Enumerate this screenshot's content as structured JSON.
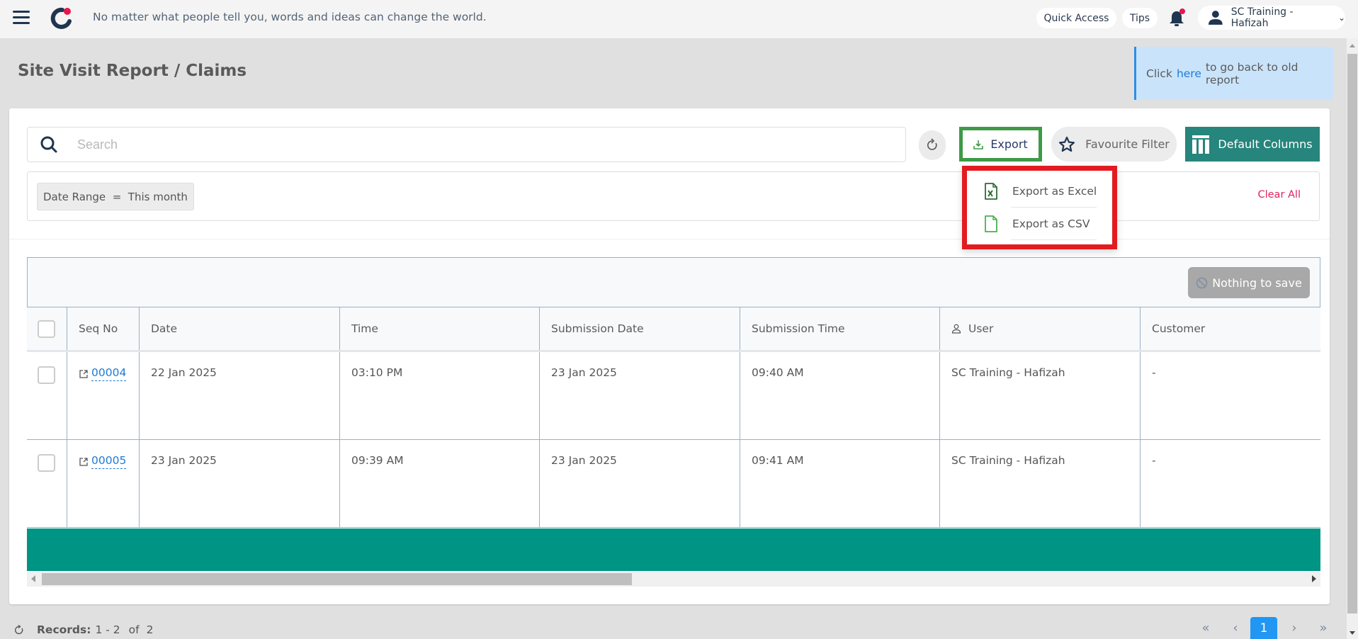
{
  "topbar": {
    "motto": "No matter what people tell you, words and ideas can change the world.",
    "quick_access": "Quick Access",
    "tips": "Tips",
    "user_name": "SC Training - Hafizah",
    "menu_icon": "hamburger-icon",
    "notification_icon": "bell-icon",
    "user_icon": "user-icon"
  },
  "page": {
    "title": "Site Visit Report / Claims",
    "banner_prefix": "Click",
    "banner_link": "here",
    "banner_suffix": "to go back to old report"
  },
  "toolbar": {
    "search_placeholder": "Search",
    "export_label": "Export",
    "favourite_label": "Favourite Filter",
    "columns_label": "Default Columns"
  },
  "filters": {
    "chip": "Date Range  =  This month",
    "clear_all": "Clear All"
  },
  "export_menu": {
    "items": [
      {
        "label": "Export as Excel",
        "icon": "excel-file-icon"
      },
      {
        "label": "Export as CSV",
        "icon": "csv-file-icon"
      }
    ]
  },
  "table": {
    "save_button": "Nothing to save",
    "columns": [
      "Seq No",
      "Date",
      "Time",
      "Submission Date",
      "Submission Time",
      "User",
      "Customer"
    ],
    "rows": [
      {
        "seq": "00004",
        "date": "22 Jan 2025",
        "time": "03:10 PM",
        "sub_date": "23 Jan 2025",
        "sub_time": "09:40 AM",
        "user": "SC Training - Hafizah",
        "customer": "-"
      },
      {
        "seq": "00005",
        "date": "23 Jan 2025",
        "time": "09:39 AM",
        "sub_date": "23 Jan 2025",
        "sub_time": "09:41 AM",
        "user": "SC Training - Hafizah",
        "customer": "-"
      }
    ]
  },
  "footer": {
    "records_label": "Records:",
    "records_range": "1 - 2",
    "records_of": "of",
    "records_total": "2",
    "current_page": "1",
    "first": "«",
    "prev": "‹",
    "next": "›",
    "last": "»"
  },
  "colors": {
    "brand_teal": "#26857c",
    "footer_teal": "#009485",
    "export_highlight": "#3e9a46",
    "dropdown_highlight": "#e31b1f",
    "link_blue": "#1e7ad6",
    "clear_all": "#e0245e",
    "page_active": "#2196f3"
  }
}
